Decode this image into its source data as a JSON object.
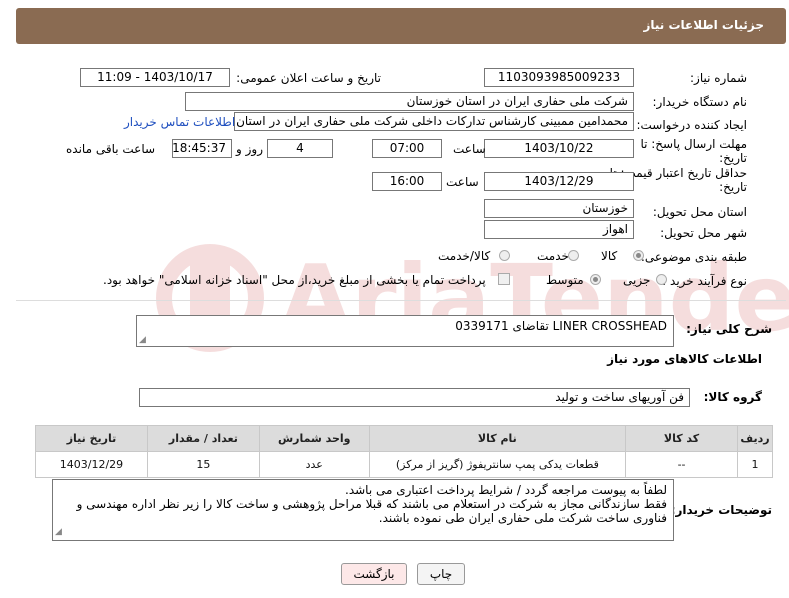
{
  "header": {
    "title": "جزئیات اطلاعات نیاز"
  },
  "form": {
    "need_number_label": "شماره نیاز:",
    "need_number": "1103093985009233",
    "announce_datetime_label": "تاریخ و ساعت اعلان عمومی:",
    "announce_datetime": "1403/10/17 - 11:09",
    "buyer_org_label": "نام دستگاه خریدار:",
    "buyer_org": "شرکت ملی حفاری ایران در استان خوزستان",
    "requester_label": "ایجاد کننده درخواست:",
    "requester": "محمدامین ممبینی کارشناس تدارکات داخلی شرکت ملی حفاری ایران در استان خ",
    "contact_link": "اطلاعات تماس خریدار",
    "deadline_label_1": "مهلت ارسال پاسخ: تا",
    "deadline_label_2": "تاریخ:",
    "deadline_date": "1403/10/22",
    "time_label": "ساعت",
    "deadline_time": "07:00",
    "days_value": "4",
    "days_label": "روز و",
    "remaining_time": "18:45:37",
    "remaining_label": "ساعت باقی مانده",
    "validity_label_1": "حداقل تاریخ اعتبار قیمت: تا",
    "validity_label_2": "تاریخ:",
    "validity_date": "1403/12/29",
    "validity_time": "16:00",
    "province_label": "استان محل تحویل:",
    "province": "خوزستان",
    "city_label": "شهر محل تحویل:",
    "city": "اهواز",
    "category_label": "طبقه بندی موضوعی:",
    "category_options": [
      "کالا",
      "خدمت",
      "کالا/خدمت"
    ],
    "category_selected": 0,
    "process_label": "نوع فرآیند خرید :",
    "process_options": [
      "جزیی",
      "متوسط"
    ],
    "process_selected": 1,
    "payment_note": "پرداخت تمام یا بخشی از مبلغ خرید،از محل \"اسناد خزانه اسلامی\" خواهد بود."
  },
  "need_desc": {
    "label": "شرح کلی نیاز:",
    "value": "تقاضای 0339171  LINER CROSSHEAD"
  },
  "goods_section": {
    "title": "اطلاعات کالاهای مورد نیاز",
    "group_label": "گروه کالا:",
    "group_value": "فن آوریهای ساخت و تولید",
    "columns": [
      "ردیف",
      "کد کالا",
      "نام کالا",
      "واحد شمارش",
      "تعداد / مقدار",
      "تاریخ نیاز"
    ],
    "rows": [
      [
        "1",
        "--",
        "قطعات یدکی پمپ سانتریفوژ (گریز از مرکز)",
        "عدد",
        "15",
        "1403/12/29"
      ]
    ]
  },
  "buyer_notes": {
    "label": "توضیحات خریدار:",
    "text": "لطفاً به پیوست مراجعه گردد / شرایط پرداخت اعتباری می باشد.\nفقط سازندگانی مجاز به شرکت در استعلام می باشند که قبلا مراحل پژوهشی و ساخت کالا را زیر نظر اداره مهندسی و فناوری ساخت شرکت ملی حفاری ایران طی نموده باشند."
  },
  "buttons": {
    "print": "چاپ",
    "back": "بازگشت"
  },
  "watermark": {
    "text": "AriaTender.neT"
  },
  "colors": {
    "header_bg": "#8a6b52",
    "link": "#1f4fbf",
    "table_header_bg": "#dcdcdc",
    "back_button_bg": "#fde8e8"
  }
}
